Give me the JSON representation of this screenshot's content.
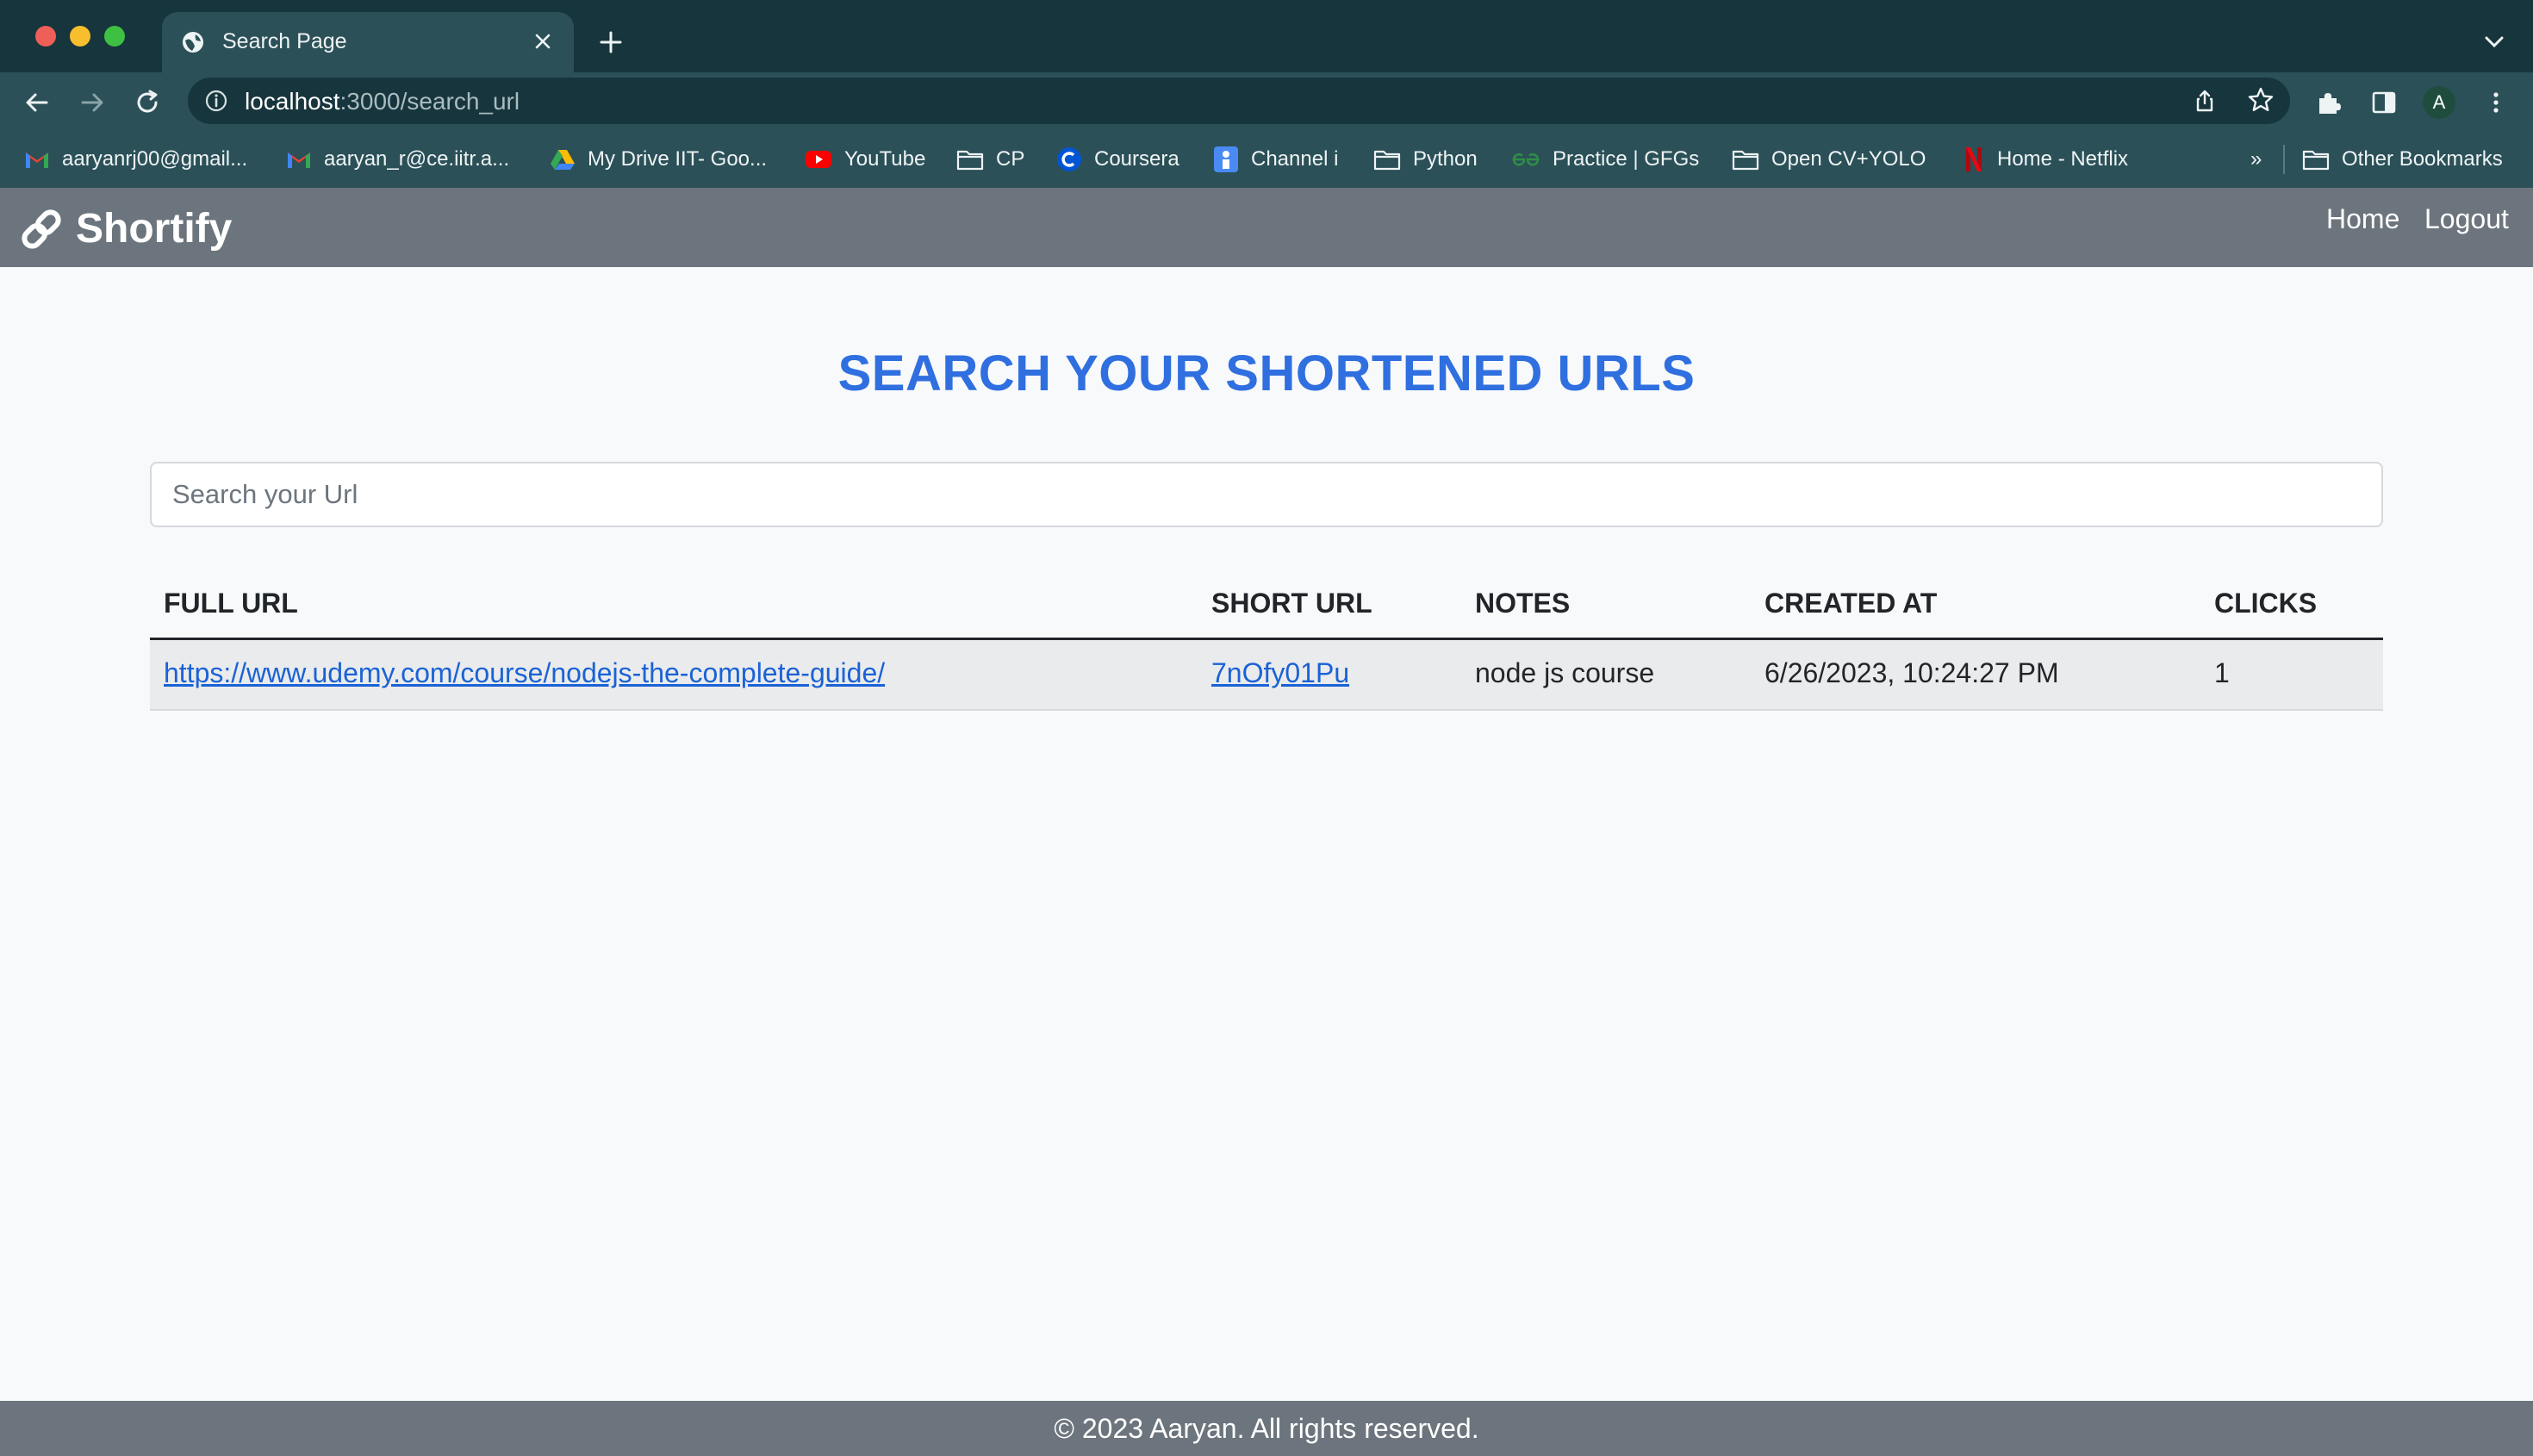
{
  "browser": {
    "tab": {
      "title": "Search Page"
    },
    "address": {
      "host": "localhost",
      "path": ":3000/search_url"
    },
    "profile_initial": "A",
    "bookmarks": [
      {
        "label": "aaryanrj00@gmail...",
        "icon": "gmail-icon"
      },
      {
        "label": "aaryan_r@ce.iitr.a...",
        "icon": "gmail-icon"
      },
      {
        "label": "My Drive IIT- Goo...",
        "icon": "google-drive-icon"
      },
      {
        "label": "YouTube",
        "icon": "youtube-icon"
      },
      {
        "label": "CP",
        "icon": "folder-icon"
      },
      {
        "label": "Coursera",
        "icon": "coursera-icon"
      },
      {
        "label": "Channel i",
        "icon": "channel-icon"
      },
      {
        "label": "Python",
        "icon": "folder-icon"
      },
      {
        "label": "Practice | GFGs",
        "icon": "gfg-icon"
      },
      {
        "label": "Open CV+YOLO",
        "icon": "folder-icon"
      },
      {
        "label": "Home - Netflix",
        "icon": "netflix-icon"
      }
    ],
    "bookmarks_overflow": "»",
    "other_bookmarks": "Other Bookmarks"
  },
  "app": {
    "brand": "Shortify",
    "nav": {
      "home": "Home",
      "logout": "Logout"
    }
  },
  "main": {
    "title": "SEARCH YOUR SHORTENED URLS",
    "search": {
      "placeholder": "Search your Url",
      "value": ""
    },
    "table": {
      "headers": [
        "FULL URL",
        "SHORT URL",
        "NOTES",
        "CREATED AT",
        "CLICKS"
      ],
      "rows": [
        {
          "full_url": "https://www.udemy.com/course/nodejs-the-complete-guide/",
          "short_url": "7nOfy01Pu",
          "notes": "node js course",
          "created_at": "6/26/2023, 10:24:27 PM",
          "clicks": "1"
        }
      ]
    }
  },
  "footer": {
    "text": "© 2023 Aaryan. All rights reserved."
  },
  "colors": {
    "title_blue": "#2f6fe0",
    "navbar_gray": "#6c757d",
    "link_blue": "#1a62d6",
    "browser_frame": "#17353d",
    "browser_toolbar": "#2b5058"
  }
}
